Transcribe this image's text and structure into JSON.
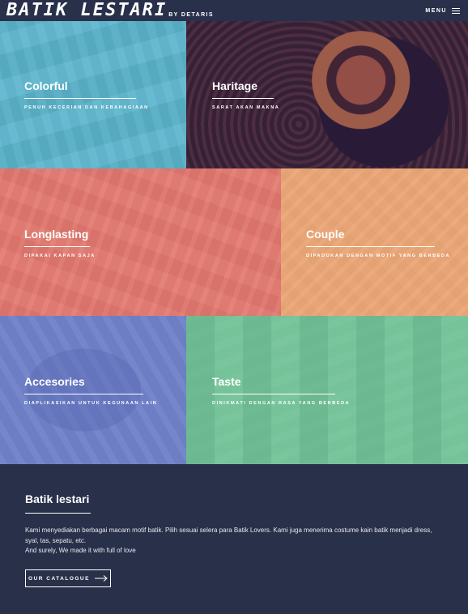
{
  "header": {
    "logo_main": "BATIK LESTARI",
    "logo_sub": "BY DETARIS",
    "menu_label": "MENU",
    "menu_icon": "hamburger-icon"
  },
  "tiles": [
    {
      "title": "Colorful",
      "subtitle": "PENUH KECERIAN DAN KEBAHAGIAAN",
      "overlay": "#5fb8d2"
    },
    {
      "title": "Haritage",
      "subtitle": "SARAT AKAN MAKNA",
      "overlay": "#29304a"
    },
    {
      "title": "Longlasting",
      "subtitle": "DIPAKAI KAPAN SAJA",
      "overlay": "#e57b73"
    },
    {
      "title": "Couple",
      "subtitle": "DIPADUKAN DENGAN MOTIF YANG BERBEDA",
      "overlay": "#efa877"
    },
    {
      "title": "Accesories",
      "subtitle": "DIAPLIKASIKAN UNTUK KEGUNAAN LAIN",
      "overlay": "#7384cc"
    },
    {
      "title": "Taste",
      "subtitle": "DINIKMATI DENGAN RASA YANG BERBEDA",
      "overlay": "#76c79c"
    }
  ],
  "footer": {
    "title": "Batik lestari",
    "paragraph_1": "Kami menyediakan berbagai macam motif batik. Pilih sesuai selera para Batik Lovers. Kami juga menerima costume kain batik menjadi dress, syal, tas, sepatu, etc.",
    "paragraph_2": "And surely, We made it with full of love",
    "button_label": "OUR CATALOGUE",
    "button_icon": "arrow-right-icon"
  },
  "colors": {
    "navy": "#29304a",
    "white": "#ffffff"
  }
}
